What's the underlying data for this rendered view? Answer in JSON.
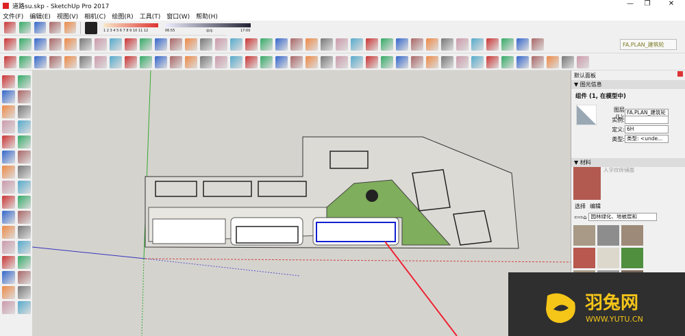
{
  "window": {
    "title": "道路su.skp - SketchUp Pro 2017",
    "minimize": "—",
    "maximize": "❐",
    "close": "✕"
  },
  "menu": [
    "文件(F)",
    "编辑(E)",
    "视图(V)",
    "相机(C)",
    "绘图(R)",
    "工具(T)",
    "窗口(W)",
    "帮助(H)"
  ],
  "shadow": {
    "months": "1 2 3 4 5 6 7 8 9 10 11 12",
    "time_start": "06:55",
    "time_mid": "中午",
    "time_end": "17:00"
  },
  "toolbar": {
    "layer_select": "FA.PLAN_建筑轮"
  },
  "toolbar1_icons": [
    "component-icon",
    "sign-in-icon",
    "upload-icon",
    "share-link-icon",
    "warehouse-icon"
  ],
  "toolbar2_icons": [
    "select-icon",
    "component-icon",
    "paint-icon",
    "eraser-icon",
    "pencil-icon",
    "freehand-icon",
    "rectangle-icon",
    "rotated-rect-icon",
    "circle-icon",
    "polygon-icon",
    "arc-icon",
    "pie-icon",
    "move-icon",
    "pushpull-icon",
    "rotate-icon",
    "scale-icon",
    "followme-icon",
    "offset-icon",
    "tape-icon",
    "dimension-icon",
    "protractor-icon",
    "text-icon",
    "axes-icon",
    "3dtext-icon",
    "orbit-icon",
    "pan-icon",
    "zoom-icon",
    "zoom-window-icon",
    "zoom-extents-icon",
    "position-camera-icon",
    "walk-icon",
    "lookaround-icon",
    "footprints-icon",
    "section-plane-icon",
    "section-display-icon",
    "section-cut-icon"
  ],
  "toolbar3_icons": [
    "select-icon",
    "eraser-icon",
    "pencil-icon",
    "arc-icon",
    "pushpull-icon",
    "followme-icon",
    "rotate-icon",
    "scale-icon",
    "tape-icon",
    "text-icon",
    "paint-icon",
    "orbit-icon",
    "pan-icon",
    "zoom-icon",
    "zoom-extents-icon",
    "previous-view-icon",
    "next-view-icon",
    "warehouse-icon",
    "extension-icon",
    "ruby-icon",
    "xray-icon",
    "back-edges-icon",
    "wireframe-icon",
    "hidden-line-icon",
    "shaded-icon",
    "textured-icon",
    "monochrome-icon",
    "iso-view-icon",
    "top-view-icon",
    "front-view-icon",
    "right-view-icon",
    "back-view-icon",
    "left-view-icon",
    "union-icon",
    "subtract-icon",
    "intersect-icon",
    "trim-icon",
    "split-icon",
    "outer-shell-icon"
  ],
  "left_icons": [
    "select-icon",
    "component-icon",
    "paint-icon",
    "eraser-icon",
    "pencil-icon",
    "freehand-icon",
    "rectangle-icon",
    "rotated-rect-icon",
    "circle-icon",
    "polygon-icon",
    "arc-icon",
    "arc2-icon",
    "arc3-icon",
    "pie-icon",
    "move-icon",
    "pushpull-icon",
    "rotate-icon",
    "followme-icon",
    "scale-icon",
    "offset-icon",
    "tape-icon",
    "dimension-icon",
    "protractor-icon",
    "text-icon",
    "axes-icon",
    "3dtext-icon",
    "orbit-icon",
    "pan-icon",
    "zoom-icon",
    "zoom-window-icon",
    "zoom-extents-icon",
    "previous-icon"
  ],
  "panel": {
    "title": "默认面板",
    "entity_info": {
      "header": "图元信息",
      "object": "组件 (1, 在模型中)",
      "layer_label": "图层(L):",
      "layer_value": "FA.PLAN_建筑轮",
      "instance_label": "实例:",
      "instance_value": "",
      "definition_label": "定义:",
      "definition_value": "6H",
      "type_label": "类型:",
      "type_value": "类型: <unde..."
    },
    "materials": {
      "header": "材料",
      "name": "人字纹砖铺面",
      "tab_select": "选择",
      "tab_edit": "编辑",
      "library": "园林绿化、地被层和"
    },
    "swatch_colors": [
      "#a89a86",
      "#8d8d8d",
      "#9e8a78",
      "#b8584f",
      "#ddd8cc",
      "#4f8f3e",
      "#a89a86",
      "#9a9a9a",
      "#7a6a5a"
    ]
  },
  "watermark": {
    "brand": "羽兔网",
    "url": "WWW.YUTU.CN",
    "color": "#f5c518"
  }
}
